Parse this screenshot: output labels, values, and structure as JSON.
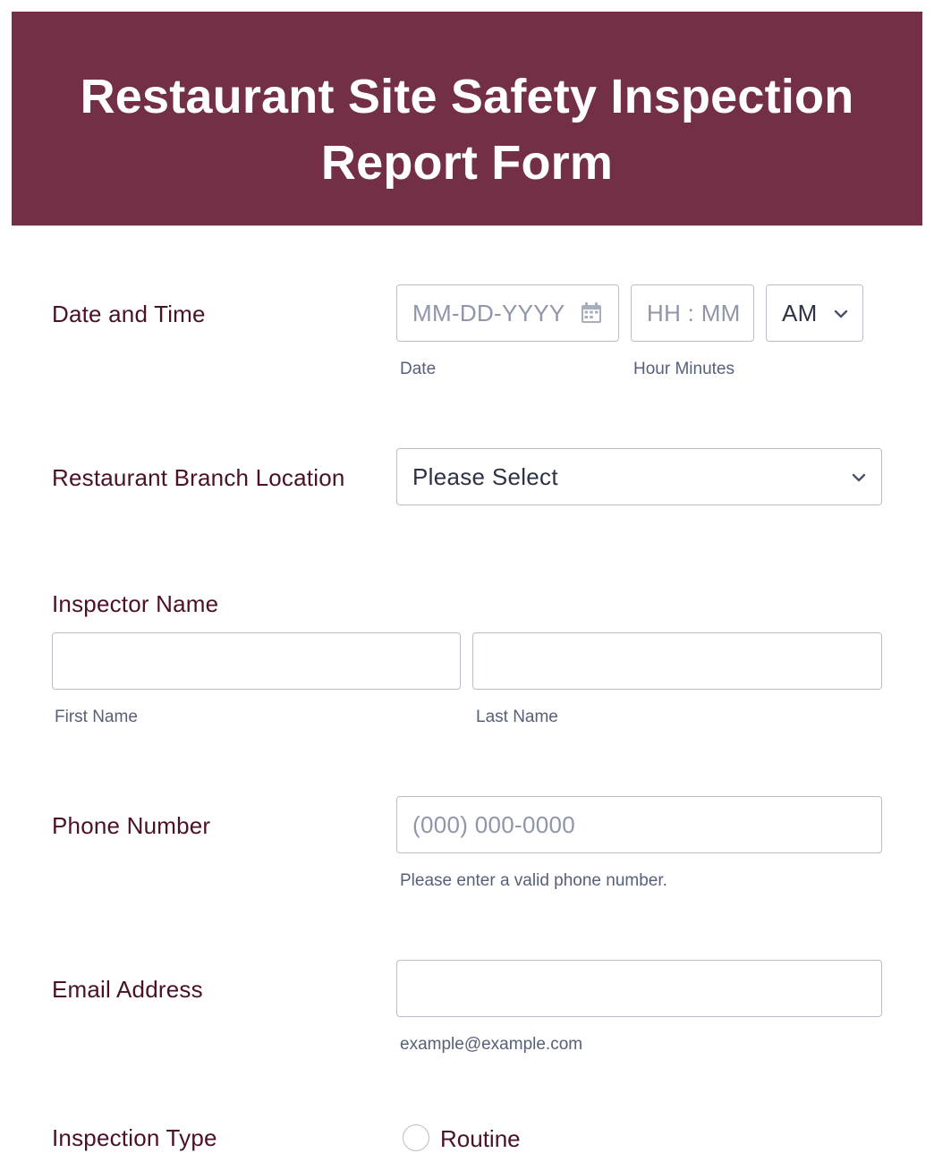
{
  "header": {
    "title": "Restaurant Site Safety Inspection\nReport Form",
    "background_color": "#722f45"
  },
  "fields": {
    "date_time": {
      "label": "Date and Time",
      "date_placeholder": "MM-DD-YYYY",
      "date_sublabel": "Date",
      "time_placeholder": "HH : MM",
      "time_sublabel": "Hour Minutes",
      "ampm_value": "AM",
      "calendar_icon": "calendar-icon"
    },
    "branch_location": {
      "label": "Restaurant Branch Location",
      "select_value": "Please Select"
    },
    "inspector_name": {
      "label": "Inspector Name",
      "first_sublabel": "First Name",
      "last_sublabel": "Last Name"
    },
    "phone": {
      "label": "Phone Number",
      "placeholder": "(000) 000-0000",
      "sublabel": "Please enter a valid phone number."
    },
    "email": {
      "label": "Email Address",
      "sublabel": "example@example.com"
    },
    "inspection_type": {
      "label": "Inspection Type",
      "options": [
        "Routine"
      ]
    }
  },
  "colors": {
    "label_text": "#4a1128",
    "sublabel_text": "#57607a",
    "input_border": "#b9bdc9",
    "placeholder_text": "#8f96aa"
  }
}
